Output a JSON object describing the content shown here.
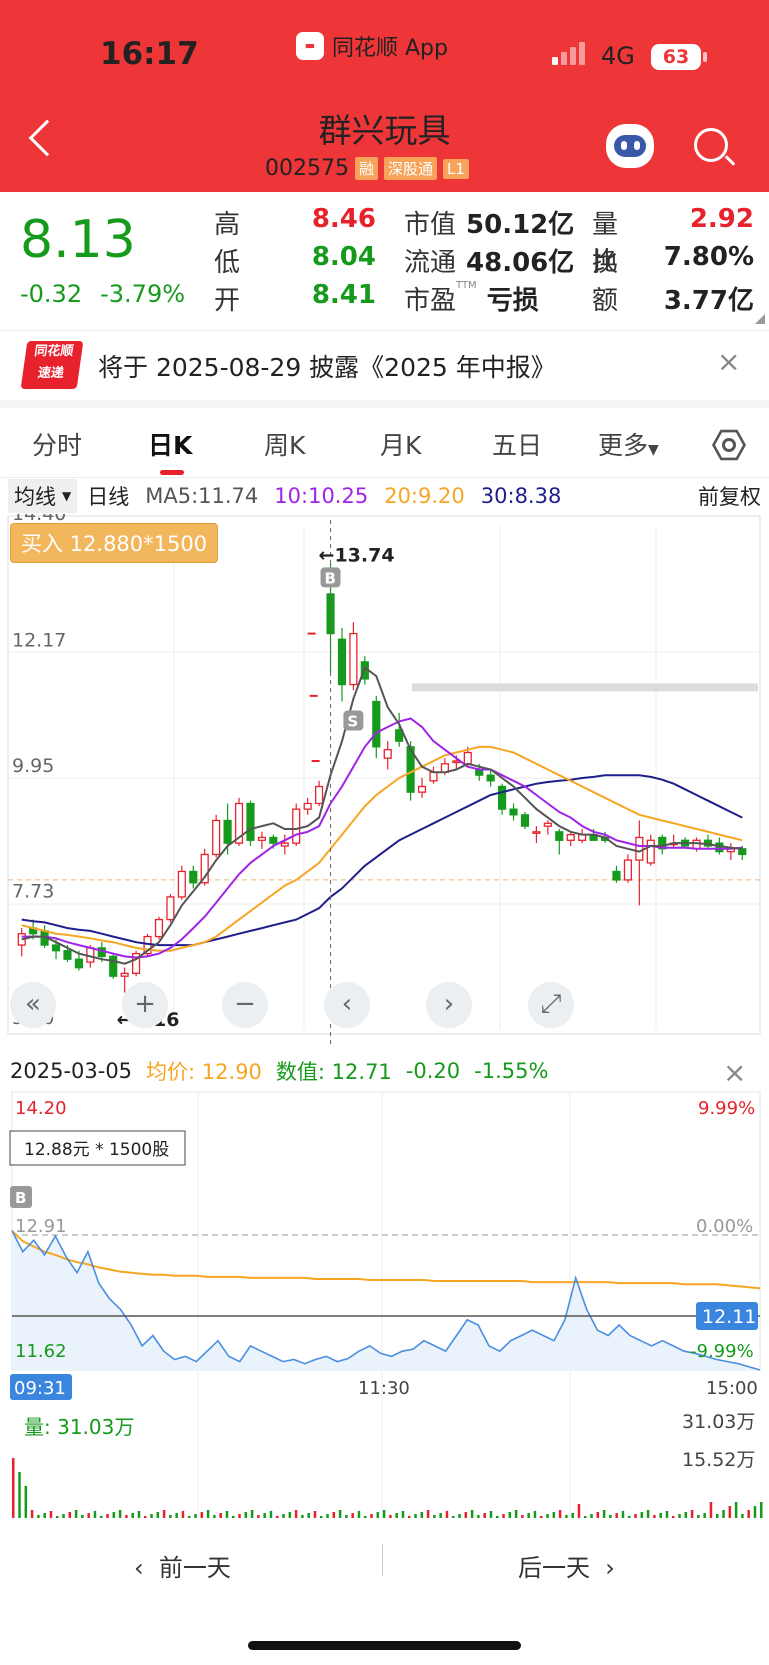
{
  "status": {
    "time": "16:17",
    "app": "同花顺 App",
    "network": "4G",
    "battery": "63"
  },
  "header": {
    "title": "群兴玩具",
    "code": "002575",
    "tags": [
      "融",
      "深股通",
      "L1"
    ]
  },
  "quote": {
    "price": "8.13",
    "change": "-0.32",
    "change_pct": "-3.79%",
    "rows": [
      {
        "l1": "高",
        "v1": "8.46",
        "c1": "red",
        "l2": "市值",
        "v2": "50.12亿",
        "l3": "量比",
        "v3": "2.92",
        "c3": "red"
      },
      {
        "l1": "低",
        "v1": "8.04",
        "c1": "green",
        "l2": "流通",
        "v2": "48.06亿",
        "l3": "换",
        "v3": "7.80%",
        "c3": "dark"
      },
      {
        "l1": "开",
        "v1": "8.41",
        "c1": "green",
        "l2": "市盈",
        "sup": "TTM",
        "v2": "亏损",
        "l3": "额",
        "v3": "3.77亿",
        "c3": "dark"
      }
    ]
  },
  "notice": {
    "logo_top": "同花顺",
    "logo_bottom": "速递",
    "text": "将于 2025-08-29 披露《2025 年中报》",
    "close": "×"
  },
  "tabs": [
    "分时",
    "日K",
    "周K",
    "月K",
    "五日",
    "更多"
  ],
  "ma": {
    "btn": "均线",
    "type": "日线",
    "ma5": "MA5:11.74",
    "ma10": "10:10.25",
    "ma20": "20:9.20",
    "ma30": "30:8.38",
    "adj": "前复权",
    "colors": {
      "ma5": "#555555",
      "ma10": "#a023e8",
      "ma20": "#f5a623",
      "ma30": "#1e1e8c"
    }
  },
  "kchart": {
    "buy_label": "买入 12.880*1500",
    "y_ticks": [
      "14.40",
      "12.17",
      "9.95",
      "7.73",
      "5.50"
    ],
    "high_note": "←13.74",
    "low_note": "←6.16",
    "b_mark": "B",
    "s_mark": "S"
  },
  "intraday": {
    "date": "2025-03-05",
    "avg_label": "均价: 12.90",
    "val_label": "数值: 12.71",
    "chg": "-0.20",
    "pct": "-1.55%",
    "left_top": "14.20",
    "right_top": "9.99%",
    "order": "12.88元 * 1500股",
    "b_mark": "B",
    "ref": "12.91",
    "ref_pct": "0.00%",
    "left_bot": "11.62",
    "right_bot": "-9.99%",
    "cur": "12.11",
    "t_start": "09:31",
    "t_mid": "11:30",
    "t_end": "15:00",
    "vol_label": "量: 31.03万",
    "vol_top": "31.03万",
    "vol_mid": "15.52万",
    "close": "×"
  },
  "chart_data": [
    {
      "type": "candlestick",
      "title": "日K",
      "y_ticks": [
        14.4,
        12.17,
        9.95,
        7.73,
        5.5
      ],
      "ohlc": [
        [
          7.0,
          7.3,
          6.8,
          7.2
        ],
        [
          7.3,
          7.45,
          7.1,
          7.2
        ],
        [
          7.25,
          7.35,
          6.95,
          7.0
        ],
        [
          7.0,
          7.1,
          6.75,
          6.9
        ],
        [
          6.9,
          7.0,
          6.7,
          6.75
        ],
        [
          6.75,
          6.9,
          6.55,
          6.6
        ],
        [
          6.7,
          7.0,
          6.6,
          6.95
        ],
        [
          6.95,
          7.05,
          6.7,
          6.8
        ],
        [
          6.8,
          6.85,
          6.4,
          6.45
        ],
        [
          6.45,
          6.6,
          6.16,
          6.5
        ],
        [
          6.5,
          6.9,
          6.45,
          6.85
        ],
        [
          6.85,
          7.2,
          6.8,
          7.15
        ],
        [
          7.15,
          7.5,
          7.1,
          7.45
        ],
        [
          7.45,
          7.9,
          7.4,
          7.85
        ],
        [
          7.85,
          8.4,
          7.8,
          8.3
        ],
        [
          8.3,
          8.4,
          8.0,
          8.1
        ],
        [
          8.1,
          8.7,
          8.05,
          8.6
        ],
        [
          8.6,
          9.3,
          8.55,
          9.2
        ],
        [
          9.2,
          9.5,
          8.6,
          8.8
        ],
        [
          8.8,
          9.6,
          8.75,
          9.5
        ],
        [
          9.5,
          9.55,
          8.75,
          8.85
        ],
        [
          8.85,
          9.0,
          8.7,
          8.9
        ],
        [
          8.9,
          8.95,
          8.7,
          8.8
        ],
        [
          8.75,
          8.95,
          8.6,
          8.8
        ],
        [
          8.8,
          9.5,
          8.75,
          9.4
        ],
        [
          9.4,
          9.6,
          9.3,
          9.5
        ],
        [
          9.5,
          9.9,
          9.45,
          9.8
        ],
        [
          13.2,
          13.74,
          11.8,
          12.5
        ],
        [
          12.4,
          12.6,
          11.3,
          11.6
        ],
        [
          11.6,
          12.7,
          11.5,
          12.5
        ],
        [
          12.0,
          12.1,
          11.6,
          11.7
        ],
        [
          11.3,
          11.4,
          10.3,
          10.5
        ],
        [
          10.3,
          10.6,
          10.1,
          10.45
        ],
        [
          10.8,
          11.1,
          10.5,
          10.6
        ],
        [
          10.5,
          10.6,
          9.55,
          9.7
        ],
        [
          9.7,
          9.95,
          9.6,
          9.8
        ],
        [
          9.9,
          10.15,
          9.85,
          10.05
        ],
        [
          10.05,
          10.3,
          10.0,
          10.2
        ],
        [
          10.25,
          10.35,
          10.1,
          10.25
        ],
        [
          10.2,
          10.5,
          10.15,
          10.4
        ],
        [
          10.1,
          10.2,
          9.9,
          10.0
        ],
        [
          10.0,
          10.1,
          9.8,
          9.9
        ],
        [
          9.8,
          9.85,
          9.3,
          9.4
        ],
        [
          9.4,
          9.5,
          9.2,
          9.3
        ],
        [
          9.3,
          9.35,
          9.05,
          9.1
        ],
        [
          9.0,
          9.1,
          8.8,
          9.0
        ],
        [
          9.1,
          9.2,
          8.95,
          9.15
        ],
        [
          9.0,
          9.05,
          8.6,
          8.85
        ],
        [
          8.85,
          9.0,
          8.75,
          8.95
        ],
        [
          8.85,
          9.05,
          8.8,
          8.95
        ],
        [
          8.95,
          9.05,
          8.85,
          8.85
        ],
        [
          8.9,
          9.0,
          8.8,
          8.85
        ],
        [
          8.3,
          8.4,
          8.1,
          8.15
        ],
        [
          8.15,
          8.6,
          8.1,
          8.5
        ],
        [
          8.5,
          9.2,
          7.7,
          8.9
        ],
        [
          8.45,
          8.95,
          8.4,
          8.85
        ],
        [
          8.9,
          8.95,
          8.6,
          8.7
        ],
        [
          8.8,
          8.95,
          8.7,
          8.8
        ],
        [
          8.85,
          8.9,
          8.75,
          8.75
        ],
        [
          8.7,
          8.9,
          8.65,
          8.85
        ],
        [
          8.85,
          8.95,
          8.7,
          8.75
        ],
        [
          8.8,
          8.9,
          8.6,
          8.65
        ],
        [
          8.65,
          8.8,
          8.5,
          8.7
        ],
        [
          8.7,
          8.75,
          8.5,
          8.6
        ]
      ],
      "ma5": [
        7.1,
        7.15,
        7.15,
        7.05,
        6.95,
        6.85,
        6.8,
        6.75,
        6.72,
        6.67,
        6.75,
        6.9,
        7.05,
        7.35,
        7.7,
        7.95,
        8.2,
        8.5,
        8.75,
        8.9,
        9.05,
        9.1,
        9.15,
        9.05,
        9.05,
        9.1,
        9.25,
        10.0,
        10.6,
        11.35,
        11.9,
        11.75,
        11.2,
        10.9,
        10.45,
        10.15,
        10.05,
        10.05,
        10.1,
        10.2,
        10.15,
        10.1,
        9.95,
        9.8,
        9.6,
        9.4,
        9.25,
        9.1,
        9.0,
        8.95,
        8.95,
        8.9,
        8.75,
        8.7,
        8.65,
        8.75,
        8.75,
        8.8,
        8.8,
        8.8,
        8.78,
        8.75,
        8.72,
        8.7
      ],
      "ma10": [
        7.15,
        7.15,
        7.15,
        7.12,
        7.05,
        7.0,
        6.95,
        6.9,
        6.85,
        6.8,
        6.78,
        6.8,
        6.85,
        6.95,
        7.1,
        7.3,
        7.5,
        7.75,
        8.0,
        8.25,
        8.45,
        8.6,
        8.75,
        8.85,
        8.95,
        9.0,
        9.1,
        9.5,
        9.8,
        10.15,
        10.5,
        10.75,
        10.85,
        10.95,
        11.0,
        10.85,
        10.6,
        10.45,
        10.3,
        10.15,
        10.1,
        10.1,
        10.0,
        9.9,
        9.8,
        9.65,
        9.5,
        9.35,
        9.25,
        9.1,
        9.0,
        8.95,
        8.85,
        8.8,
        8.75,
        8.75,
        8.72,
        8.72,
        8.72,
        8.7,
        8.7,
        8.7,
        8.7,
        8.72
      ],
      "ma20": [
        7.35,
        7.3,
        7.25,
        7.2,
        7.18,
        7.15,
        7.12,
        7.08,
        7.05,
        7.0,
        6.95,
        6.92,
        6.9,
        6.9,
        6.95,
        7.0,
        7.05,
        7.15,
        7.3,
        7.45,
        7.6,
        7.75,
        7.9,
        8.05,
        8.15,
        8.3,
        8.45,
        8.7,
        8.95,
        9.2,
        9.45,
        9.65,
        9.8,
        9.95,
        10.05,
        10.15,
        10.25,
        10.35,
        10.4,
        10.45,
        10.5,
        10.5,
        10.45,
        10.4,
        10.3,
        10.2,
        10.1,
        10.0,
        9.9,
        9.8,
        9.7,
        9.6,
        9.5,
        9.4,
        9.3,
        9.25,
        9.2,
        9.15,
        9.1,
        9.05,
        9.0,
        8.95,
        8.9,
        8.85
      ],
      "ma30": [
        7.45,
        7.42,
        7.4,
        7.35,
        7.3,
        7.27,
        7.25,
        7.2,
        7.15,
        7.1,
        7.05,
        7.02,
        7.0,
        7.0,
        7.0,
        7.0,
        7.05,
        7.1,
        7.15,
        7.2,
        7.25,
        7.3,
        7.35,
        7.4,
        7.45,
        7.55,
        7.65,
        7.85,
        8.0,
        8.2,
        8.4,
        8.55,
        8.7,
        8.85,
        8.95,
        9.05,
        9.15,
        9.25,
        9.35,
        9.45,
        9.55,
        9.65,
        9.7,
        9.75,
        9.8,
        9.85,
        9.88,
        9.9,
        9.92,
        9.95,
        9.97,
        10.0,
        10.0,
        10.0,
        10.0,
        9.97,
        9.92,
        9.85,
        9.75,
        9.65,
        9.55,
        9.45,
        9.35,
        9.25
      ]
    },
    {
      "type": "line",
      "title": "分时",
      "x_labels": [
        "09:31",
        "11:30",
        "15:00"
      ],
      "ylim": [
        11.62,
        14.2
      ],
      "ref": 12.91,
      "price": [
        12.95,
        12.75,
        12.86,
        12.72,
        12.9,
        12.7,
        12.55,
        12.75,
        12.45,
        12.3,
        12.2,
        12.05,
        11.85,
        11.95,
        11.8,
        11.72,
        11.75,
        11.7,
        11.8,
        11.9,
        11.75,
        11.7,
        11.85,
        11.8,
        11.75,
        11.7,
        11.72,
        11.68,
        11.72,
        11.75,
        11.7,
        11.73,
        11.8,
        11.85,
        11.78,
        11.75,
        11.8,
        11.82,
        11.9,
        11.85,
        11.8,
        11.95,
        12.1,
        12.05,
        11.85,
        11.8,
        11.9,
        11.95,
        12.0,
        11.95,
        11.9,
        12.1,
        12.5,
        12.2,
        12.0,
        11.95,
        12.05,
        11.95,
        11.9,
        11.85,
        11.9,
        11.85,
        11.8,
        11.78,
        11.75,
        11.72,
        11.7,
        11.68,
        11.65,
        11.62
      ],
      "avg": [
        12.95,
        12.85,
        12.8,
        12.75,
        12.72,
        12.68,
        12.65,
        12.63,
        12.6,
        12.58,
        12.56,
        12.55,
        12.54,
        12.53,
        12.53,
        12.52,
        12.52,
        12.52,
        12.51,
        12.51,
        12.51,
        12.51,
        12.5,
        12.5,
        12.5,
        12.5,
        12.5,
        12.5,
        12.49,
        12.49,
        12.49,
        12.49,
        12.49,
        12.48,
        12.48,
        12.48,
        12.48,
        12.48,
        12.48,
        12.47,
        12.47,
        12.47,
        12.47,
        12.47,
        12.47,
        12.47,
        12.47,
        12.47,
        12.46,
        12.46,
        12.46,
        12.46,
        12.46,
        12.46,
        12.46,
        12.46,
        12.45,
        12.45,
        12.45,
        12.45,
        12.45,
        12.45,
        12.44,
        12.44,
        12.44,
        12.44,
        12.43,
        12.42,
        12.41,
        12.4
      ]
    }
  ]
}
